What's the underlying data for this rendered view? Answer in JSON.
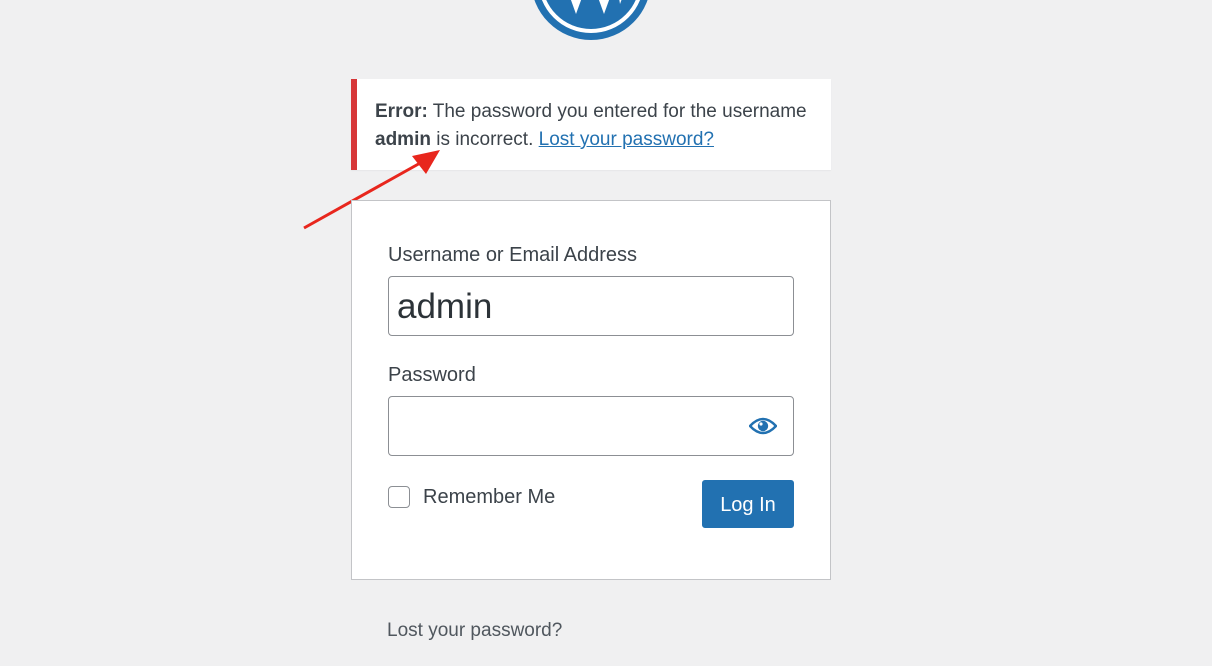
{
  "logo": {
    "icon": "wordpress-logo-icon",
    "color": "#2271b1"
  },
  "notice": {
    "error_prefix": "Error:",
    "message_part1": "The password you entered for the username",
    "username": "admin",
    "message_part2": "is incorrect.",
    "lost_link": "Lost your password?",
    "border_color": "#d63638"
  },
  "form": {
    "username_label": "Username or Email Address",
    "username_value": "admin",
    "password_label": "Password",
    "password_value": "",
    "show_password_icon": "eye-icon",
    "remember_label": "Remember Me",
    "remember_checked": false,
    "submit_label": "Log In",
    "accent_color": "#2271b1"
  },
  "footer": {
    "lost_password": "Lost your password?"
  }
}
